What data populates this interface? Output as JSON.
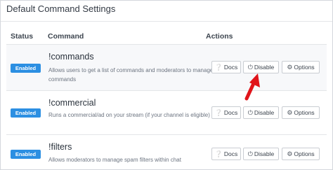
{
  "panel": {
    "title": "Default Command Settings"
  },
  "table": {
    "headers": {
      "status": "Status",
      "command": "Command",
      "actions": "Actions"
    },
    "rows": [
      {
        "status": "Enabled",
        "name": "!commands",
        "description": "Allows users to get a list of commands and moderators to manage commands"
      },
      {
        "status": "Enabled",
        "name": "!commercial",
        "description": "Runs a commercial/ad on your stream (if your channel is eligible)"
      },
      {
        "status": "Enabled",
        "name": "!filters",
        "description": "Allows moderators to manage spam filters within chat"
      }
    ],
    "actions": {
      "docs": "Docs",
      "disable": "Disable",
      "options": "Options"
    }
  },
  "icons": {
    "docs": "question-circle-icon",
    "disable": "power-icon",
    "options": "gears-icon"
  },
  "colors": {
    "badge": "#2c8fe2",
    "highlight_arrow": "#e0141a",
    "row_highlight": "#f7f8fa"
  }
}
